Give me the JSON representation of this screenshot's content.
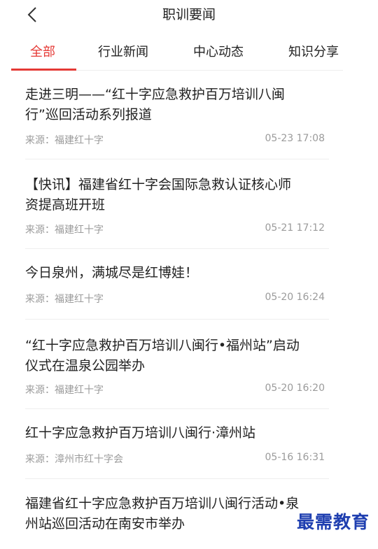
{
  "header": {
    "title": "职训要闻"
  },
  "tabs": [
    {
      "label": "全部"
    },
    {
      "label": "行业新闻"
    },
    {
      "label": "中心动态"
    },
    {
      "label": "知识分享"
    }
  ],
  "articles": [
    {
      "title_line1": "走进三明——“红十字应急救护百万培训八闽",
      "title_line2": "行”巡回活动系列报道",
      "source": "来源：福建红十字",
      "time": "05-23 17:08"
    },
    {
      "title_line1": "【快讯】福建省红十字会国际急救认证核心师",
      "title_line2": "资提高班开班",
      "source": "来源：福建红十字",
      "time": "05-21 17:12"
    },
    {
      "title_line1": "今日泉州，满城尽是红博娃！",
      "source": "来源：福建红十字",
      "time": "05-20 16:24"
    },
    {
      "title_line1": "“红十字应急救护百万培训八闽行•福州站”启动",
      "title_line2": "仪式在温泉公园举办",
      "source": "来源：福建红十字",
      "time": "05-20 16:20"
    },
    {
      "title_line1": "红十字应急救护百万培训八闽行·漳州站",
      "source": "来源：漳州市红十字会",
      "time": "05-16 16:31"
    },
    {
      "title_line1": "福建省红十字应急救护百万培训八闽行活动•泉",
      "title_line2": "州站巡回活动在南安市举办"
    }
  ],
  "watermark": "最需教育",
  "colors": {
    "accent": "#e53935",
    "meta_text": "#9b9b9b",
    "watermark": "#1f3fb0"
  }
}
